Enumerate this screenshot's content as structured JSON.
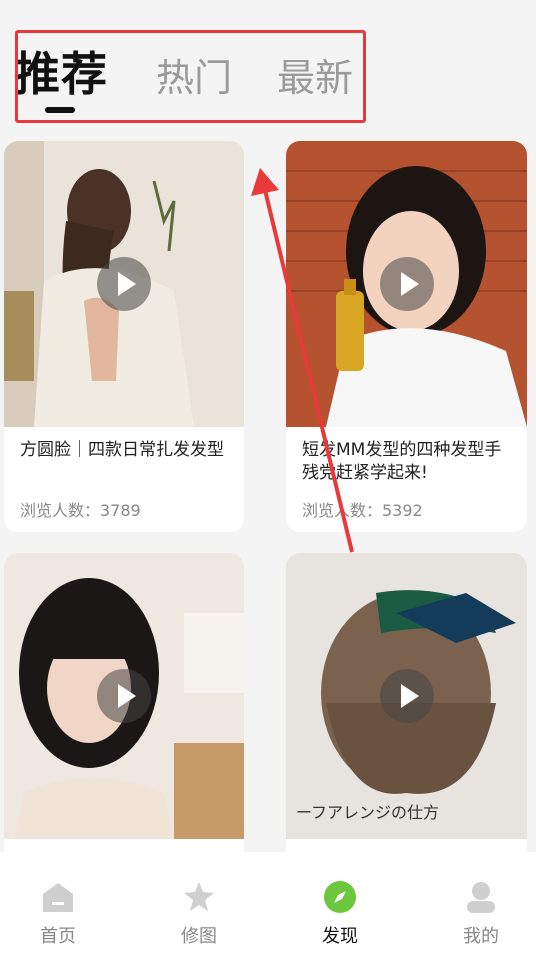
{
  "tabs": [
    {
      "label": "推荐",
      "active": true
    },
    {
      "label": "热门",
      "active": false
    },
    {
      "label": "最新",
      "active": false
    }
  ],
  "cards": [
    {
      "title": "方圆脸｜四款日常扎发发型",
      "views": "浏览人数：3789"
    },
    {
      "title": "短发MM发型的四种发型手残党赶紧学起来!",
      "views": "浏览人数：5392"
    },
    {
      "title": "",
      "views": ""
    },
    {
      "title": "",
      "views": ""
    }
  ],
  "bottom_nav": [
    {
      "label": "首页",
      "icon": "home-icon",
      "active": false
    },
    {
      "label": "修图",
      "icon": "star-edit-icon",
      "active": false
    },
    {
      "label": "发现",
      "icon": "compass-icon",
      "active": true
    },
    {
      "label": "我的",
      "icon": "profile-icon",
      "active": false
    }
  ],
  "colors": {
    "accent": "#6cc73f",
    "annotation": "#e83a3a",
    "text": "#111111",
    "muted": "#888888"
  }
}
